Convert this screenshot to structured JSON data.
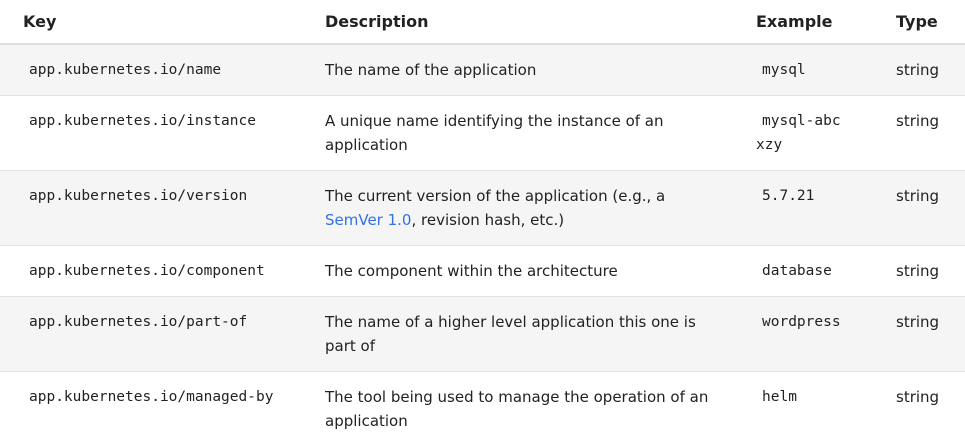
{
  "headers": {
    "key": "Key",
    "description": "Description",
    "example": "Example",
    "type": "Type"
  },
  "rows": [
    {
      "key": "app.kubernetes.io/name",
      "description": "The name of the application",
      "example": "mysql",
      "type": "string"
    },
    {
      "key": "app.kubernetes.io/instance",
      "description": "A unique name identifying the instance of an application",
      "example": "mysql-abcxzy",
      "type": "string"
    },
    {
      "key": "app.kubernetes.io/version",
      "description_before": "The current version of the application (e.g., a ",
      "description_link": "SemVer 1.0",
      "description_after": ", revision hash, etc.)",
      "example": "5.7.21",
      "type": "string"
    },
    {
      "key": "app.kubernetes.io/component",
      "description": "The component within the architecture",
      "example": "database",
      "type": "string"
    },
    {
      "key": "app.kubernetes.io/part-of",
      "description": "The name of a higher level application this one is part of",
      "example": "wordpress",
      "type": "string"
    },
    {
      "key": "app.kubernetes.io/managed-by",
      "description": "The tool being used to manage the operation of an application",
      "example": "helm",
      "type": "string"
    }
  ],
  "colors": {
    "link": "#3371e3",
    "row_shade": "#f5f5f5",
    "border": "#e2e2e2"
  }
}
